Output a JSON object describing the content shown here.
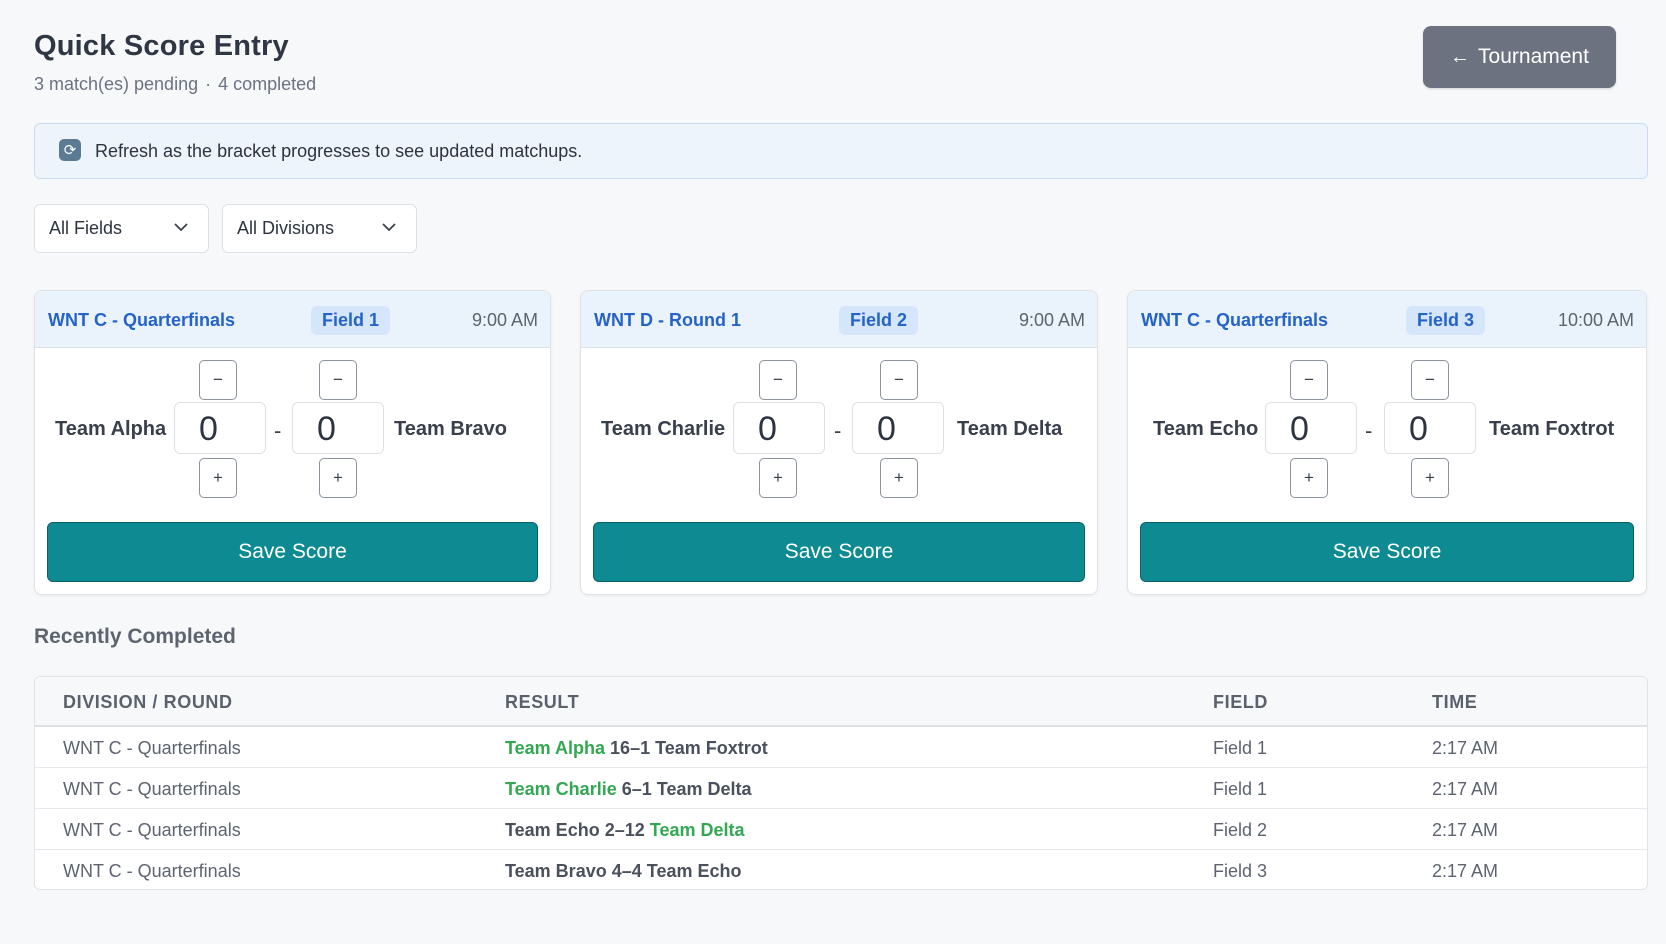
{
  "header": {
    "title": "Quick Score Entry",
    "pending_text": "3 match(es) pending",
    "separator": "·",
    "completed_text": "4 completed",
    "back_button": {
      "arrow": "←",
      "label": "Tournament"
    }
  },
  "banner": {
    "icon": "refresh-icon",
    "text": "Refresh as the bracket progresses to see updated matchups."
  },
  "filters": {
    "fields": "All Fields",
    "divisions": "All Divisions"
  },
  "matches": [
    {
      "division": "WNT C - Quarterfinals",
      "field": "Field 1",
      "time": "9:00 AM",
      "team1": "Team Alpha",
      "team2": "Team Bravo",
      "score1": "0",
      "score2": "0",
      "dash": "-",
      "minus": "−",
      "plus": "+",
      "save": "Save Score"
    },
    {
      "division": "WNT D - Round 1",
      "field": "Field 2",
      "time": "9:00 AM",
      "team1": "Team Charlie",
      "team2": "Team Delta",
      "score1": "0",
      "score2": "0",
      "dash": "-",
      "minus": "−",
      "plus": "+",
      "save": "Save Score"
    },
    {
      "division": "WNT C - Quarterfinals",
      "field": "Field 3",
      "time": "10:00 AM",
      "team1": "Team Echo",
      "team2": "Team Foxtrot",
      "score1": "0",
      "score2": "0",
      "dash": "-",
      "minus": "−",
      "plus": "+",
      "save": "Save Score"
    }
  ],
  "recent": {
    "title": "Recently Completed",
    "columns": [
      "DIVISION / ROUND",
      "RESULT",
      "FIELD",
      "TIME"
    ],
    "rows": [
      {
        "division": "WNT C - Quarterfinals",
        "team1": "Team Alpha",
        "score": "16–1",
        "team2": "Team Foxtrot",
        "winner": 1,
        "field": "Field 1",
        "time": "2:17 AM"
      },
      {
        "division": "WNT C - Quarterfinals",
        "team1": "Team Charlie",
        "score": "6–1",
        "team2": "Team Delta",
        "winner": 1,
        "field": "Field 1",
        "time": "2:17 AM"
      },
      {
        "division": "WNT C - Quarterfinals",
        "team1": "Team Echo",
        "score": "2–12",
        "team2": "Team Delta",
        "winner": 2,
        "field": "Field 2",
        "time": "2:17 AM"
      },
      {
        "division": "WNT C - Quarterfinals",
        "team1": "Team Bravo",
        "score": "4–4",
        "team2": "Team Echo",
        "winner": 0,
        "field": "Field 3",
        "time": "2:17 AM"
      }
    ]
  },
  "colors": {
    "accent": "#0e8a92",
    "link_blue": "#2563c9",
    "winner_green": "#33a852",
    "back_button": "#6c7280"
  }
}
